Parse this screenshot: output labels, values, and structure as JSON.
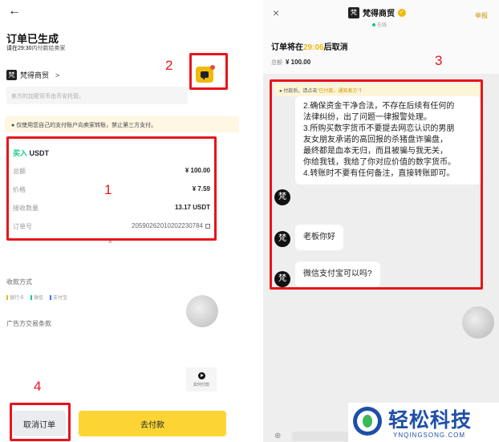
{
  "left": {
    "order_title": "订单已生成",
    "pay_hint_time": "请在29:30",
    "pay_hint_rest": "内付款给卖家",
    "merchant_logo": "梵",
    "merchant_name": "梵得商贸",
    "merchant_chevron": ">",
    "desc_placeholder": "卖方的加密货币由币安托管。",
    "notice": "仅使用您自己的支付账户向卖家转账，禁止第三方支付。",
    "buy_prefix": "买入",
    "buy_asset": "USDT",
    "rows": [
      {
        "label": "总额",
        "value": "¥ 100.00"
      },
      {
        "label": "价格",
        "value": "¥ 7.59"
      },
      {
        "label": "接收数量",
        "value": "13.17 USDT"
      },
      {
        "label": "订单号",
        "value": "20590262010202230784"
      }
    ],
    "payment_method_label": "收款方式",
    "pay_methods": [
      "银行卡",
      "微信",
      "支付宝"
    ],
    "pay_method_colors": [
      "#f0b90b",
      "#0ecb81",
      "#2f7cf6"
    ],
    "terms_label": "广告方交易条款",
    "howto_label": "如何付款",
    "cancel_button": "取消订单",
    "pay_button": "去付款"
  },
  "right": {
    "close": "×",
    "merchant_logo": "梵",
    "merchant_name": "梵得商贸",
    "verified": "✓",
    "online": "在线",
    "report": "举报",
    "cancel_prefix": "订单将在",
    "countdown": "29:06",
    "cancel_suffix": "后取消",
    "total_label": "总额",
    "total_value": "¥ 100.00",
    "notice_prefix": "付款后，请点击",
    "notice_highlight": "\"已付款，通知卖方\"",
    "notice_suffix": "！",
    "message_lines": [
      "2.确保资金干净合法，不存在后续有任何的",
      "法律纠纷，出了问题一律报警处理。",
      "3.所购买数字货币不要提去网恋认识的男朋",
      "友女朋友承诺的高回报的杀猪盘诈骗盘，",
      "最终都是血本无归，而且被骗与我无关，",
      "你给我钱，我给了你对应价值的数字货币。",
      "4.转账时不要有任何备注，直接转账即可。"
    ],
    "message_2": "老板你好",
    "message_3": "微信支付宝可以吗?",
    "avatar_char": "梵"
  },
  "annotations": [
    "1",
    "2",
    "3",
    "4"
  ],
  "watermark": {
    "text": "轻松科技",
    "sub": "YNQINGSONG.COM"
  },
  "colors": {
    "accent_yellow": "#fcd535",
    "buy_green": "#0ecb81",
    "annotation_red": "#e8141b",
    "watermark_blue": "#1e4fa7"
  }
}
